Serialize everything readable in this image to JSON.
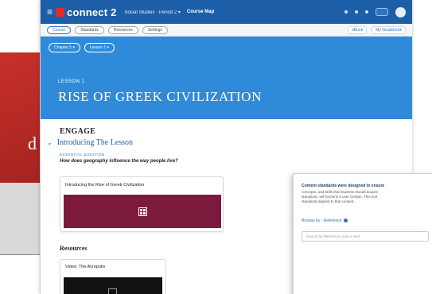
{
  "background": {
    "left_card_letter": "d",
    "left_card_color": "#c8302b"
  },
  "topbar": {
    "menu_icon": "hamburger-icon",
    "logo_text": "connect 2",
    "course_selector": "Social Studies · Period 2 ▾",
    "map_link": "Course Map",
    "color": "#1d5ea8"
  },
  "subnav": {
    "pills": [
      "Course",
      "Standards",
      "Resources",
      "Settings"
    ],
    "right_buttons": [
      "eBook",
      "My Gradebook"
    ]
  },
  "hero": {
    "chapter_pill": "Chapter 5 ▾",
    "lesson_pill": "Lesson 1 ▾",
    "lesson_number": "LESSON 1",
    "lesson_title": "RISE OF GREEK CIVILIZATION",
    "color": "#2f8bd9"
  },
  "content": {
    "section_heading": "ENGAGE",
    "subsection": "Introducing The Lesson",
    "eq_label": "ESSENTIAL QUESTION",
    "eq_text": "How does geography influence the way people live?",
    "card_title": "Introducing the Rise of Greek Civilization",
    "card_media_color": "#7c1a3e",
    "resources_heading": "Resources",
    "resource_title": "Video: The Acropolis"
  },
  "standards_panel": {
    "heading": "Content standards were designed to ensure",
    "body_lines": [
      "concepts, and skills that students should acquire",
      "standards, will formerly a user Certain. This tool",
      "standards aligned to that content."
    ],
    "browse_label": "Browse by : Reference",
    "search_placeholder": "Search by Reference code or text"
  }
}
